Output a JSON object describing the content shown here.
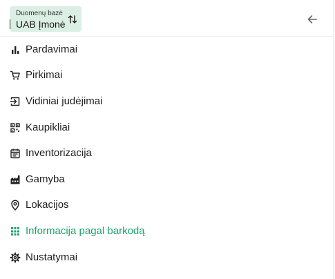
{
  "header": {
    "database_label": "Duomenų bazė",
    "database_value": "UAB Įmonė",
    "swap_icon": "swap-vertical-icon",
    "back_icon": "arrow-left-icon"
  },
  "menu": {
    "items": [
      {
        "label": "Pardavimai",
        "icon": "bar-chart-icon"
      },
      {
        "label": "Pirkimai",
        "icon": "shopping-cart-icon"
      },
      {
        "label": "Vidiniai judėjimai",
        "icon": "login-arrow-icon"
      },
      {
        "label": "Kaupikliai",
        "icon": "qr-scan-icon"
      },
      {
        "label": "Inventorizacija",
        "icon": "calendar-list-icon"
      },
      {
        "label": "Gamyba",
        "icon": "factory-icon"
      },
      {
        "label": "Lokacijos",
        "icon": "location-pin-icon"
      },
      {
        "label": "Informacija pagal barkodą",
        "icon": "grid-dots-icon",
        "active": true
      },
      {
        "label": "Nustatymai",
        "icon": "gear-icon"
      }
    ]
  },
  "colors": {
    "accent": "#1aa36a",
    "selector_bg": "#dcefe5",
    "text": "#1f1f1f"
  }
}
